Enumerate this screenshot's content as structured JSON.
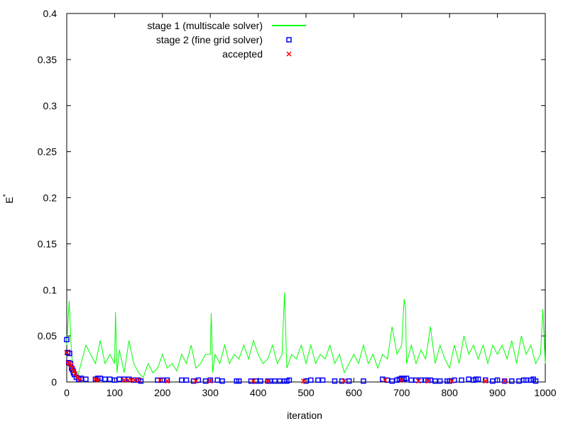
{
  "chart_data": {
    "type": "scatter",
    "title": "",
    "xlabel": "iteration",
    "ylabel": "E",
    "ylabel_superscript": "*",
    "xlim": [
      0,
      1000
    ],
    "ylim": [
      0,
      0.4
    ],
    "xticks": [
      "0",
      "100",
      "200",
      "300",
      "400",
      "500",
      "600",
      "700",
      "800",
      "900",
      "1000"
    ],
    "yticks": [
      "0",
      "0.05",
      "0.1",
      "0.15",
      "0.2",
      "0.25",
      "0.3",
      "0.35",
      "0.4"
    ],
    "legend_position": "top-left",
    "series": [
      {
        "name": "stage 1 (multiscale solver)",
        "kind": "line",
        "color": "#00ff00",
        "x": [
          0,
          5,
          10,
          15,
          20,
          25,
          30,
          40,
          50,
          60,
          70,
          80,
          90,
          100,
          102,
          105,
          110,
          120,
          130,
          140,
          150,
          160,
          170,
          180,
          190,
          200,
          210,
          220,
          230,
          240,
          250,
          260,
          270,
          280,
          290,
          300,
          302,
          305,
          310,
          320,
          330,
          340,
          350,
          360,
          370,
          380,
          390,
          400,
          410,
          420,
          430,
          440,
          450,
          455,
          460,
          470,
          480,
          490,
          500,
          510,
          520,
          530,
          540,
          550,
          560,
          570,
          580,
          590,
          600,
          610,
          620,
          630,
          640,
          650,
          660,
          670,
          680,
          690,
          700,
          705,
          708,
          710,
          720,
          730,
          740,
          750,
          760,
          770,
          780,
          790,
          800,
          810,
          820,
          830,
          840,
          850,
          860,
          870,
          880,
          890,
          900,
          910,
          920,
          930,
          940,
          950,
          960,
          970,
          980,
          990,
          995,
          1000
        ],
        "y": [
          0.04,
          0.088,
          0.03,
          0.01,
          0.005,
          0.01,
          0.02,
          0.04,
          0.03,
          0.02,
          0.045,
          0.02,
          0.03,
          0.02,
          0.076,
          0.01,
          0.035,
          0.01,
          0.045,
          0.02,
          0.01,
          0.005,
          0.02,
          0.01,
          0.015,
          0.03,
          0.015,
          0.02,
          0.012,
          0.03,
          0.02,
          0.04,
          0.015,
          0.02,
          0.03,
          0.03,
          0.075,
          0.01,
          0.03,
          0.02,
          0.04,
          0.02,
          0.03,
          0.025,
          0.04,
          0.025,
          0.045,
          0.03,
          0.02,
          0.025,
          0.04,
          0.02,
          0.03,
          0.097,
          0.015,
          0.03,
          0.025,
          0.04,
          0.02,
          0.04,
          0.02,
          0.03,
          0.025,
          0.04,
          0.02,
          0.03,
          0.01,
          0.02,
          0.03,
          0.02,
          0.04,
          0.02,
          0.03,
          0.015,
          0.03,
          0.025,
          0.06,
          0.03,
          0.04,
          0.09,
          0.08,
          0.02,
          0.04,
          0.02,
          0.035,
          0.025,
          0.06,
          0.02,
          0.04,
          0.025,
          0.015,
          0.04,
          0.02,
          0.05,
          0.03,
          0.04,
          0.025,
          0.04,
          0.02,
          0.04,
          0.03,
          0.04,
          0.025,
          0.045,
          0.02,
          0.05,
          0.03,
          0.04,
          0.02,
          0.03,
          0.079,
          0.02
        ]
      },
      {
        "name": "stage 2 (fine grid solver)",
        "kind": "square",
        "color": "#0000ff",
        "x": [
          0,
          2,
          4,
          6,
          8,
          10,
          12,
          14,
          16,
          20,
          25,
          30,
          40,
          60,
          65,
          70,
          80,
          90,
          100,
          110,
          120,
          130,
          140,
          150,
          155,
          190,
          200,
          210,
          240,
          250,
          265,
          275,
          290,
          300,
          315,
          325,
          355,
          360,
          385,
          395,
          405,
          420,
          425,
          435,
          445,
          455,
          460,
          465,
          500,
          510,
          525,
          535,
          560,
          575,
          590,
          620,
          660,
          670,
          680,
          690,
          695,
          700,
          705,
          710,
          720,
          730,
          740,
          750,
          755,
          760,
          770,
          780,
          795,
          800,
          810,
          825,
          840,
          850,
          855,
          860,
          875,
          890,
          900,
          915,
          930,
          945,
          955,
          960,
          970,
          975,
          980
        ],
        "y": [
          0.046,
          0.032,
          0.021,
          0.031,
          0.02,
          0.015,
          0.013,
          0.01,
          0.008,
          0.005,
          0.003,
          0.004,
          0.003,
          0.003,
          0.004,
          0.004,
          0.003,
          0.003,
          0.002,
          0.003,
          0.003,
          0.003,
          0.002,
          0.002,
          0.001,
          0.002,
          0.002,
          0.002,
          0.002,
          0.002,
          0.001,
          0.002,
          0.001,
          0.002,
          0.002,
          0.001,
          0.001,
          0.001,
          0.001,
          0.001,
          0.001,
          0.001,
          0.001,
          0.001,
          0.001,
          0.001,
          0.001,
          0.002,
          0.001,
          0.002,
          0.002,
          0.002,
          0.001,
          0.001,
          0.001,
          0.001,
          0.003,
          0.002,
          0.001,
          0.002,
          0.003,
          0.004,
          0.003,
          0.004,
          0.002,
          0.002,
          0.002,
          0.002,
          0.002,
          0.002,
          0.001,
          0.001,
          0.001,
          0.001,
          0.002,
          0.002,
          0.003,
          0.002,
          0.003,
          0.003,
          0.002,
          0.001,
          0.002,
          0.001,
          0.001,
          0.001,
          0.002,
          0.002,
          0.002,
          0.003,
          0.001
        ]
      },
      {
        "name": "accepted",
        "kind": "cross",
        "color": "#ff0000",
        "x": [
          0,
          3,
          6,
          9,
          12,
          15,
          18,
          22,
          28,
          60,
          65,
          120,
          128,
          135,
          142,
          150,
          195,
          210,
          270,
          300,
          390,
          420,
          495,
          580,
          665,
          700,
          735,
          755,
          805,
          875,
          915
        ],
        "y": [
          0.032,
          0.021,
          0.02,
          0.018,
          0.015,
          0.012,
          0.009,
          0.005,
          0.003,
          0.003,
          0.002,
          0.002,
          0.002,
          0.002,
          0.002,
          0.002,
          0.002,
          0.001,
          0.001,
          0.001,
          0.001,
          0.001,
          0.001,
          0.001,
          0.002,
          0.002,
          0.001,
          0.001,
          0.001,
          0.001,
          0.001
        ]
      }
    ]
  }
}
